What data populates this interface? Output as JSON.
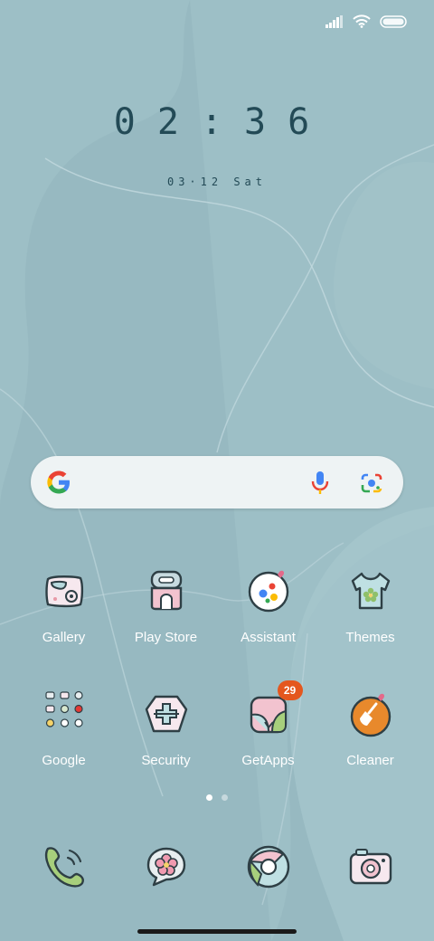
{
  "status_bar": {
    "signal_icon": "signal-bars-icon",
    "wifi_icon": "wifi-icon",
    "battery_icon": "battery-icon"
  },
  "clock": {
    "time": "02:36"
  },
  "date": {
    "text": "03·12 Sat"
  },
  "search": {
    "logo_icon": "google-g-icon",
    "mic_icon": "mic-icon",
    "lens_icon": "google-lens-icon"
  },
  "apps": [
    {
      "label": "Gallery",
      "icon": "gallery-icon"
    },
    {
      "label": "Play Store",
      "icon": "play-store-icon"
    },
    {
      "label": "Assistant",
      "icon": "assistant-icon"
    },
    {
      "label": "Themes",
      "icon": "themes-shirt-icon"
    },
    {
      "label": "Google",
      "icon": "google-folder-icon"
    },
    {
      "label": "Security",
      "icon": "security-icon"
    },
    {
      "label": "GetApps",
      "icon": "getapps-icon",
      "badge": "29"
    },
    {
      "label": "Cleaner",
      "icon": "cleaner-broom-icon"
    }
  ],
  "page_indicator": {
    "pages": 2,
    "current": 1
  },
  "dock": [
    {
      "icon": "phone-icon"
    },
    {
      "icon": "messages-icon"
    },
    {
      "icon": "browser-icon"
    },
    {
      "icon": "camera-icon"
    }
  ],
  "colors": {
    "wallpaper": "#9dbfc6",
    "wallpaper_shade": "#94b6bd",
    "text_dark": "#234a56",
    "badge": "#e4571e"
  }
}
